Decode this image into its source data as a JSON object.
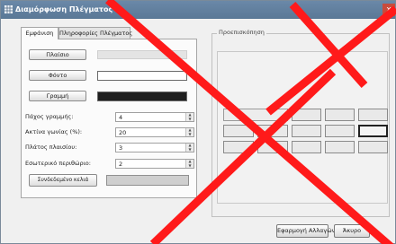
{
  "window": {
    "title": "Διαμόρφωση Πλέγματος",
    "close_glyph": "x"
  },
  "tabs": [
    {
      "label": "Εμφάνιση",
      "active": true
    },
    {
      "label": "Πληροφορίες Πλέγματος",
      "active": false
    }
  ],
  "appearance": {
    "background_button": "Πλαίσιο",
    "font_button": "Φόντο",
    "line_button": "Γραμμή",
    "background_color": "#e4e4e4",
    "font_color": "#ffffff",
    "line_color": "#1f1f1f",
    "line_thickness_label": "Πάχος γραμμής:",
    "line_thickness_value": "4",
    "corner_radius_label": "Ακτίνα γωνίας (%):",
    "corner_radius_value": "20",
    "padding_label": "Πλάτος πλαισίου:",
    "padding_value": "3",
    "inner_margin_label": "Εσωτερικό περιθώριο:",
    "inner_margin_value": "2",
    "selected_cell_button": "Συνδεδεμένο κελιά",
    "selected_cell_color": "#cfcfcf"
  },
  "preview": {
    "label": "Προεπισκόπηση"
  },
  "footer": {
    "apply_button": "Εφαρμογή Αλλαγών",
    "cancel_button": "Άκυρο"
  },
  "colors": {
    "titlebar": "#6a88a8",
    "watermark": "#ff1a1a"
  },
  "icons": {
    "title": "grid-icon",
    "close": "close-icon",
    "spin": "spin-arrows-icon"
  }
}
